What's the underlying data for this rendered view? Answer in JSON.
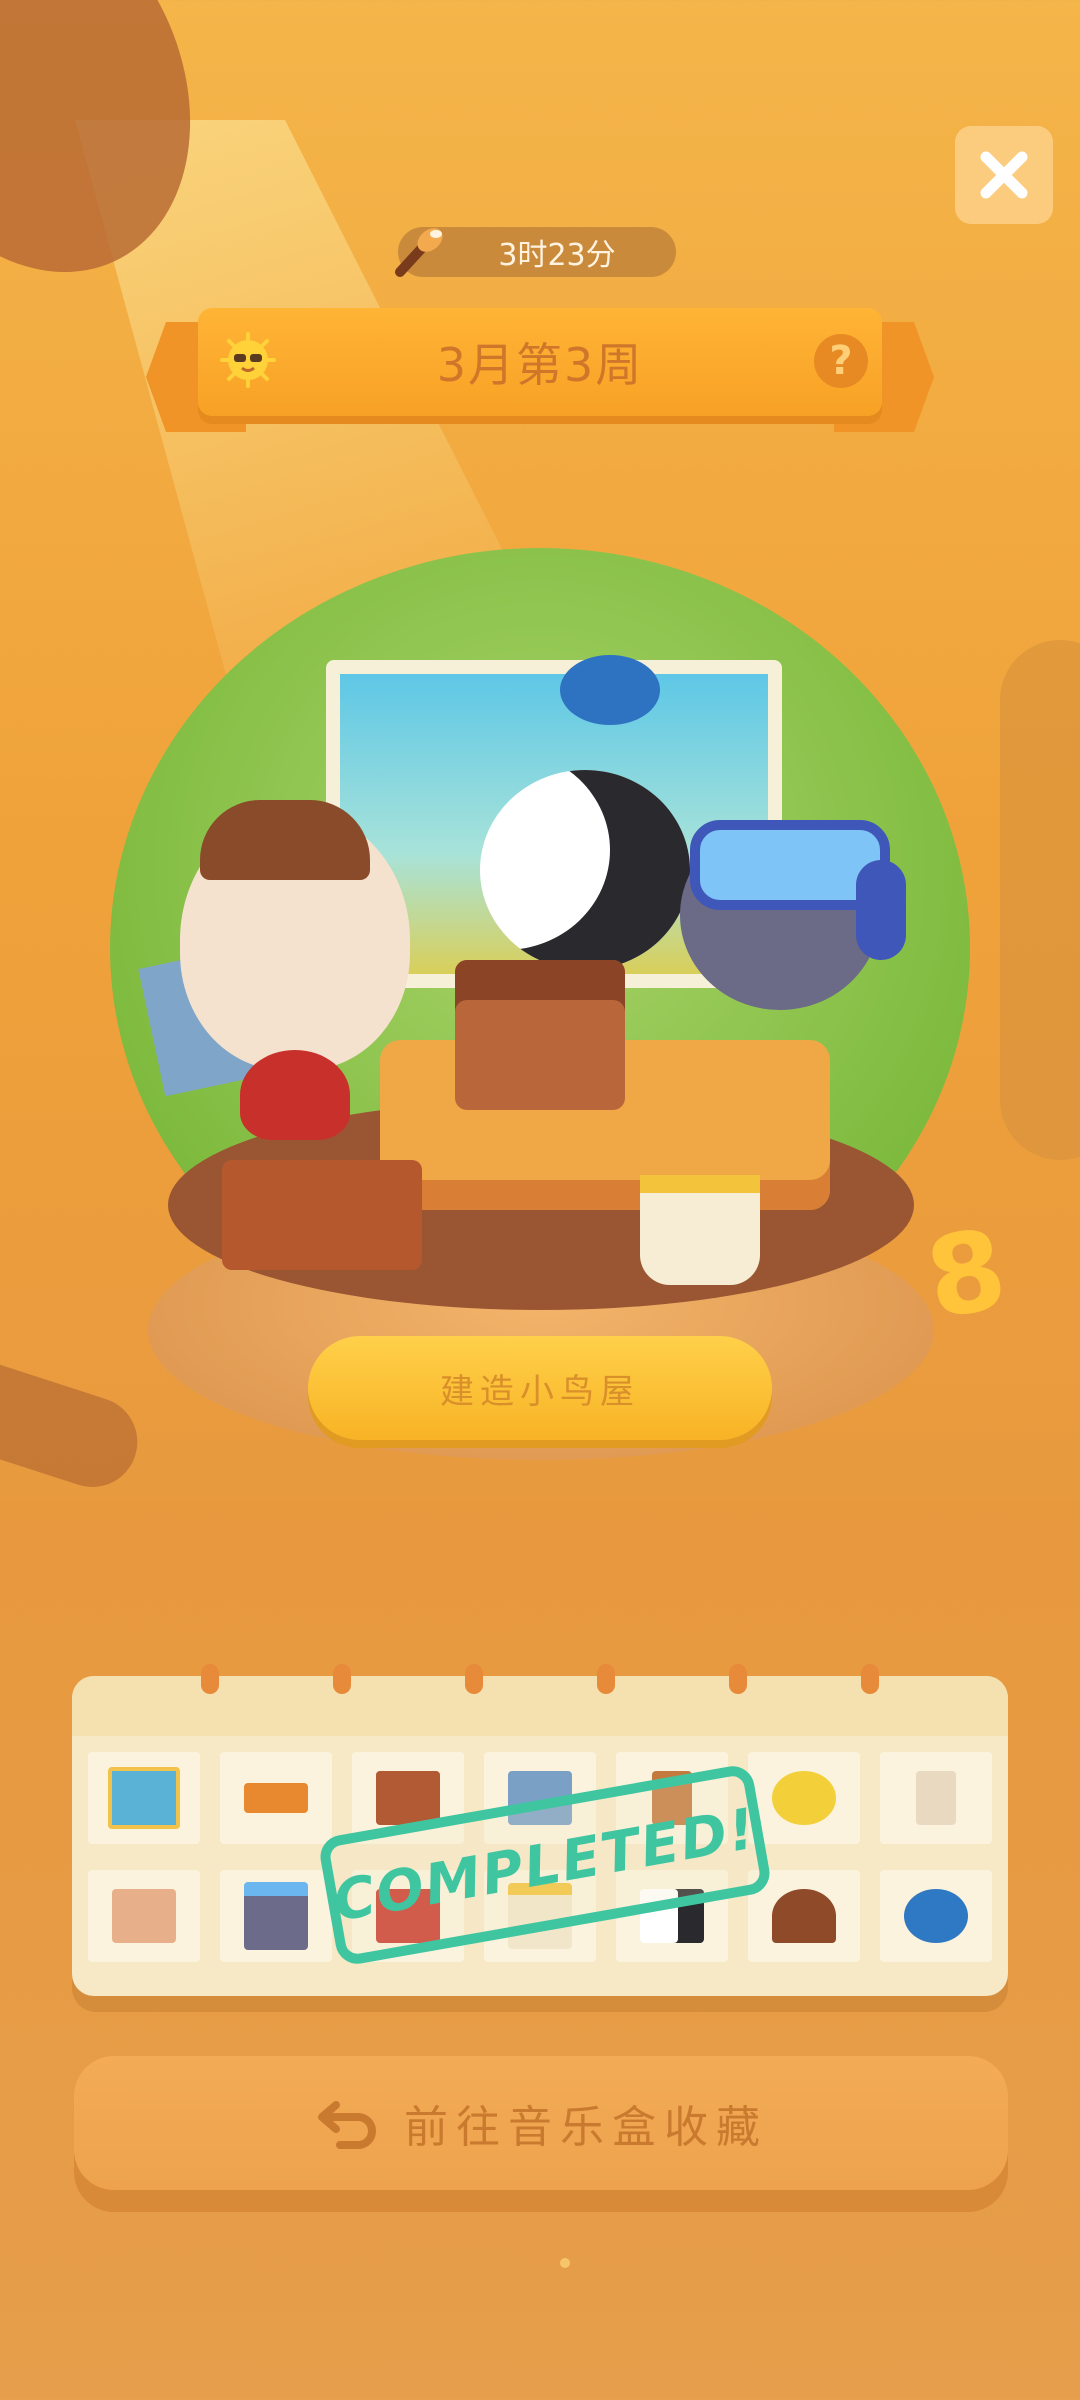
{
  "timer": {
    "text": "3时23分",
    "icon": "paintbrush-icon"
  },
  "header": {
    "title": "3月第3周",
    "left_icon": "sun-sunglasses-icon",
    "help_label": "?"
  },
  "close_button": {
    "icon": "close-icon"
  },
  "scene": {
    "plaque_label": "建造小鸟屋",
    "floating_number": "8"
  },
  "calendar": {
    "stamp_text": "COMPLETED!",
    "row1": [
      "landscape-painting",
      "wooden-bench",
      "birdhouse",
      "blueprint",
      "sticks",
      "yellow-bird",
      "glue-bottle"
    ],
    "row2": [
      "engineer-cat",
      "goggles-cat",
      "red-bird",
      "paint-can",
      "dalmatian-dog",
      "birdhouse-brown",
      "blue-bird"
    ]
  },
  "footer": {
    "button_label": "前往音乐盒收藏",
    "button_icon": "return-arrow-icon"
  },
  "colors": {
    "accent": "#f7a125",
    "stamp": "#3fc6a0",
    "background": "#f0a23a"
  }
}
